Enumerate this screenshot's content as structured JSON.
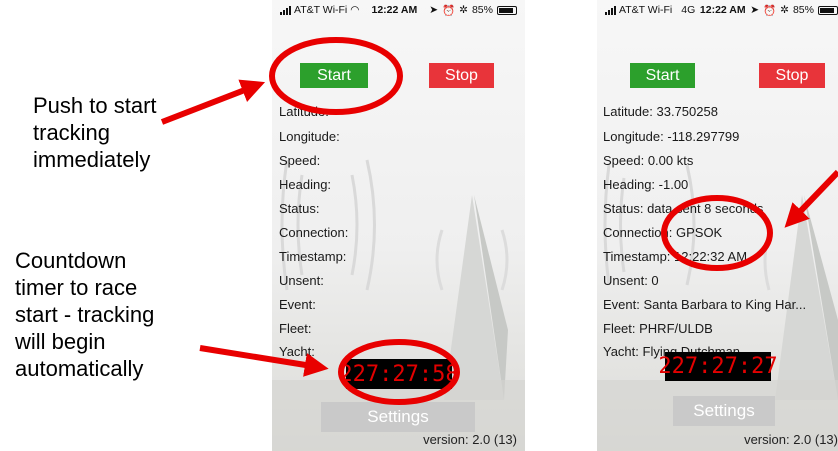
{
  "annotations": {
    "start_note": [
      "Push to start",
      "tracking",
      "immediately"
    ],
    "countdown_note": [
      "Countdown",
      "timer to race",
      "start - tracking",
      "will begin",
      "automatically"
    ]
  },
  "phone_left": {
    "status": {
      "carrier": "AT&T Wi-Fi",
      "time": "12:22 AM",
      "battery": "85%"
    },
    "start_label": "Start",
    "stop_label": "Stop",
    "fields": [
      "Latitude:",
      "Longitude:",
      "Speed:",
      "Heading:",
      "Status:",
      "Connection:",
      "Timestamp:",
      "Unsent:",
      "Event:",
      "Fleet:",
      "Yacht:"
    ],
    "timer": "227:27:58",
    "settings_label": "Settings",
    "version": "version: 2.0 (13)"
  },
  "phone_right": {
    "status": {
      "carrier": "AT&T Wi-Fi",
      "network": "4G",
      "time": "12:22 AM",
      "battery": "85%"
    },
    "start_label": "Start",
    "stop_label": "Stop",
    "fields": [
      "Latitude: 33.750258",
      "Longitude: -118.297799",
      "Speed: 0.00 kts",
      "Heading: -1.00",
      "Status: data sent 8 seconds",
      "Connection: GPSOK",
      "Timestamp: 12:22:32 AM",
      "Unsent: 0",
      "Event: Santa Barbara to King Har...",
      "Fleet: PHRF/ULDB",
      "Yacht: Flying Dutchman"
    ],
    "timer": "227:27:27",
    "settings_label": "Settings",
    "version": "version: 2.0 (13)"
  },
  "colors": {
    "start": "#2ca02c",
    "stop": "#e8343a",
    "annotation": "#e80000",
    "timer_text": "#e30000"
  }
}
